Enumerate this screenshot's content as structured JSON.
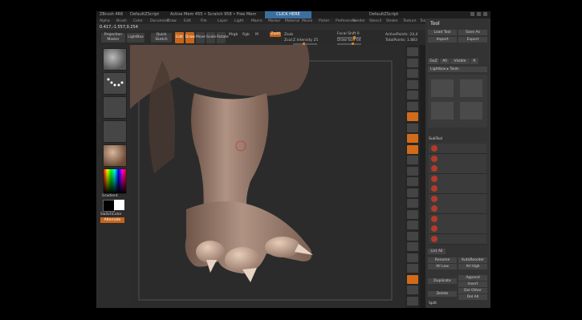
{
  "titlebar": {
    "left_text": "ZBrush 4R6",
    "project": "DefaultZScript",
    "info": "Active Mem 455 • Scratch 958 • Free Mem",
    "highlight": "CLICK HERE",
    "right_text": "DefaultZScript"
  },
  "menu": [
    "Alpha",
    "Brush",
    "Color",
    "Document",
    "Draw",
    "Edit",
    "File",
    "Layer",
    "Light",
    "Macro",
    "Marker",
    "Material",
    "Movie",
    "Picker",
    "Preferences",
    "Render",
    "Stencil",
    "Stroke",
    "Texture",
    "Tool",
    "Transform",
    "Zplugin",
    "Zscript"
  ],
  "coords": "0.417,-1.557,0.254",
  "toolbar": {
    "projection_master": "Projection Master",
    "lightbox": "LightBox",
    "quick_sketch": "Quick Sketch",
    "edit": "Edit",
    "draw": "Draw",
    "move": "Move",
    "scale": "Scale",
    "rotate": "Rotate",
    "mrgb": "Mrgb",
    "rgb": "Rgb",
    "m": "M",
    "zadd": "Zadd",
    "zsub": "Zsub",
    "zcut": "Zcut",
    "focal_shift": "Focal Shift 0",
    "z_intensity": "Z Intensity 25",
    "draw_size": "Draw Size 64",
    "active_points": "ActivePoints: 24,4",
    "total_points": "TotalPoints: 1.883"
  },
  "left": {
    "gradient": "Gradient",
    "switchcolor": "SwitchColor",
    "alternate": "Alternate"
  },
  "panel": {
    "title": "Tool",
    "load_tool": "Load Tool",
    "save_as": "Save As",
    "import": "Import",
    "export": "Export",
    "goz": "GoZ",
    "all": "All",
    "visible": "Visible",
    "r": "R",
    "lightbox_tools": "Lightbox ▸ Tools",
    "subtool": "SubTool",
    "list_all": "List All",
    "rename": "Rename",
    "auto_reorder": "AutoReorder",
    "all_low": "All Low",
    "all_high": "All High",
    "duplicate": "Duplicate",
    "append": "Append",
    "insert": "Insert",
    "delete": "Delete",
    "del_other": "Del Other",
    "del_all": "Del All",
    "split": "Split",
    "merge": "Merge",
    "remesh": "Remesh",
    "tool_names": [
      "SimpleBrush",
      "Polysphere",
      "Cylinder3D",
      "PolyMesh3D"
    ]
  },
  "colors": {
    "accent": "#d06b1c",
    "app_bg": "#2f2f2f",
    "canvas_bg": "#2b2b2b"
  }
}
